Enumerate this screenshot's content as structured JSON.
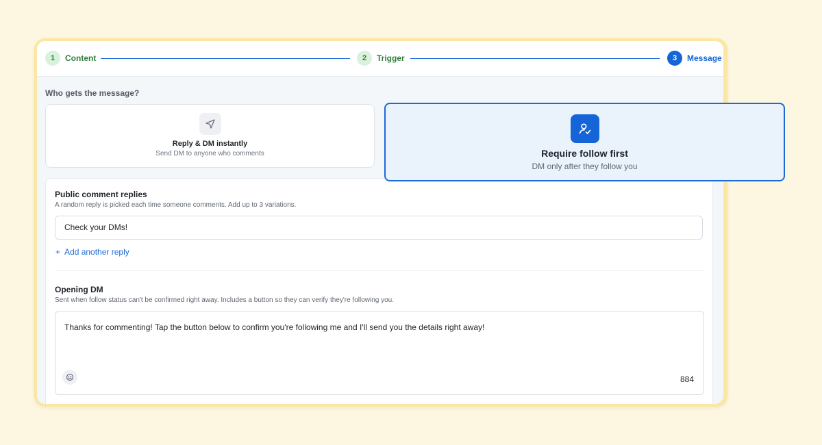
{
  "stepper": {
    "steps": [
      {
        "number": "1",
        "label": "Content",
        "state": "done"
      },
      {
        "number": "2",
        "label": "Trigger",
        "state": "done"
      },
      {
        "number": "3",
        "label": "Message",
        "state": "active"
      }
    ]
  },
  "audience": {
    "question": "Who gets the message?",
    "options": [
      {
        "title": "Reply & DM instantly",
        "subtitle": "Send DM to anyone who comments",
        "icon": "send-icon",
        "selected": false
      },
      {
        "title": "Require follow first",
        "subtitle": "DM only after they follow you",
        "icon": "user-check-icon",
        "selected": true
      }
    ]
  },
  "public_replies": {
    "title": "Public comment replies",
    "help": "A random reply is picked each time someone comments. Add up to 3 variations.",
    "replies": [
      "Check your DMs!"
    ],
    "add_label": "Add another reply",
    "add_icon": "plus-icon"
  },
  "opening_dm": {
    "title": "Opening DM",
    "help": "Sent when follow status can't be confirmed right away. Includes a button so they can verify they're following you.",
    "message": "Thanks for commenting! Tap the button below to confirm you're following me and I'll send you the details right away!",
    "char_count": "884",
    "emoji_icon": "smile-icon"
  },
  "colors": {
    "accent": "#1565d8",
    "done_green": "#2f7d3d",
    "background": "#fdf6e1",
    "frame": "#fbe6a2"
  }
}
